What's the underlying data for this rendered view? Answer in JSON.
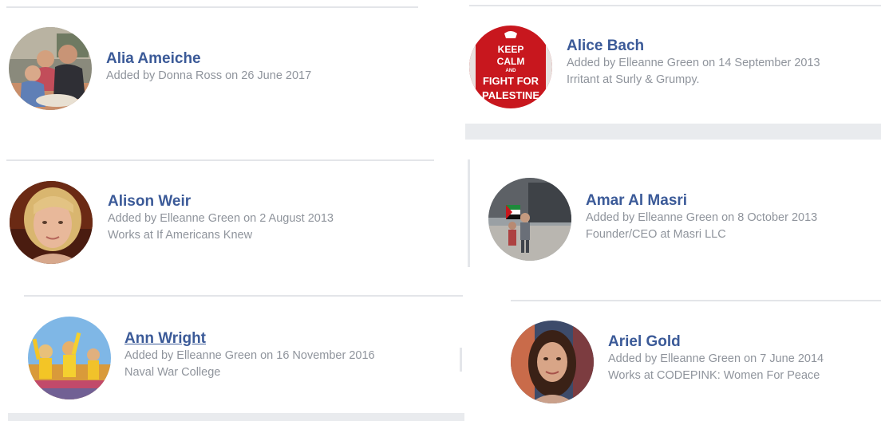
{
  "friends": [
    {
      "name": "Alia Ameiche",
      "added": "Added by Donna Ross on 26 June 2017",
      "work": "",
      "avatar": "family-photo"
    },
    {
      "name": "Alice Bach",
      "added": "Added by Elleanne Green on 14 September 2013",
      "work": "Irritant at Surly & Grumpy.",
      "avatar": "keep-calm-poster",
      "avatar_text": [
        "KEEP",
        "CALM",
        "AND",
        "FIGHT FOR",
        "PALESTINE"
      ]
    },
    {
      "name": "Alison Weir",
      "added": "Added by Elleanne Green on 2 August 2013",
      "work": "Works at If Americans Knew",
      "avatar": "portrait-blonde-woman"
    },
    {
      "name": "Amar Al Masri",
      "added": "Added by Elleanne Green on 8 October 2013",
      "work": "Founder/CEO at Masri LLC",
      "avatar": "protest-photo"
    },
    {
      "name": "Ann Wright",
      "added": "Added by Elleanne Green on 16 November 2016",
      "work": "Naval War College",
      "avatar": "crowd-photo"
    },
    {
      "name": "Ariel Gold",
      "added": "Added by Elleanne Green on 7 June 2014",
      "work": "Works at CODEPINK: Women For Peace",
      "avatar": "portrait-dark-hair-woman"
    }
  ],
  "colors": {
    "name_link": "#3b5a98",
    "meta_text": "#8f949c",
    "divider": "#e3e5e9",
    "band": "#e9ebee"
  }
}
